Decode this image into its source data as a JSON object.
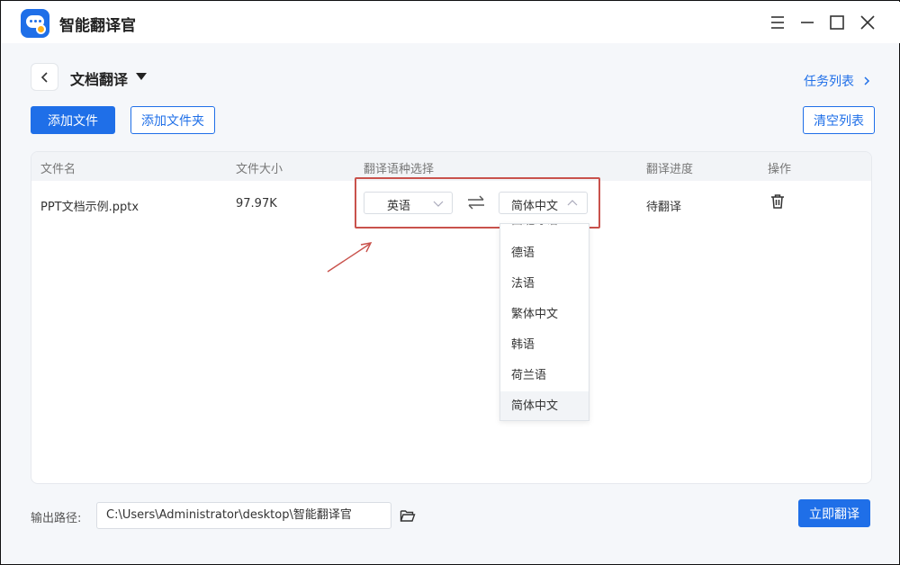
{
  "window": {
    "title": "智能翻译官"
  },
  "header": {
    "page_title": "文档翻译",
    "task_link": "任务列表"
  },
  "toolbar": {
    "add_file": "添加文件",
    "add_folder": "添加文件夹",
    "clear_list": "清空列表"
  },
  "table": {
    "columns": [
      "文件名",
      "文件大小",
      "翻译语种选择",
      "翻译进度",
      "操作"
    ],
    "rows": [
      {
        "file_name": "PPT文档示例.pptx",
        "file_size": "97.97K",
        "source_lang": "英语",
        "target_lang": "简体中文",
        "progress": "待翻译"
      }
    ]
  },
  "dropdown": {
    "partial_item": "西班牙语",
    "items": [
      "德语",
      "法语",
      "繁体中文",
      "韩语",
      "荷兰语",
      "简体中文"
    ],
    "selected": "简体中文"
  },
  "footer": {
    "output_label": "输出路径:",
    "output_path": "C:\\Users\\Administrator\\desktop\\智能翻译官",
    "translate_button": "立即翻译"
  },
  "colors": {
    "accent": "#1f6fe8",
    "highlight": "#c9524c"
  }
}
